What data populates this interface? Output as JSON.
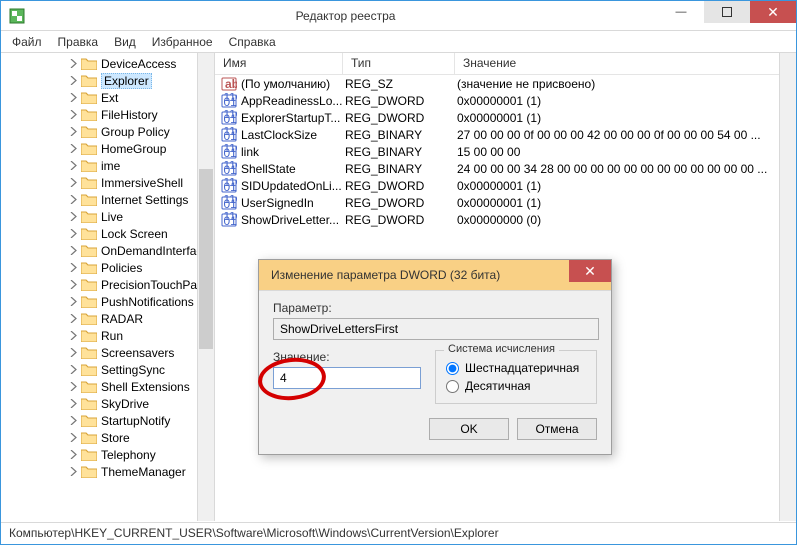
{
  "window": {
    "title": "Редактор реестра"
  },
  "menu": {
    "file": "Файл",
    "edit": "Правка",
    "view": "Вид",
    "fav": "Избранное",
    "help": "Справка"
  },
  "tree": {
    "items": [
      {
        "label": "DeviceAccess",
        "depth": 0,
        "exp": true
      },
      {
        "label": "Explorer",
        "depth": 0,
        "exp": true,
        "selected": true
      },
      {
        "label": "Ext",
        "depth": 0,
        "exp": false
      },
      {
        "label": "FileHistory",
        "depth": 0,
        "exp": false
      },
      {
        "label": "Group Policy",
        "depth": 0,
        "exp": false
      },
      {
        "label": "HomeGroup",
        "depth": 0,
        "exp": false
      },
      {
        "label": "ime",
        "depth": 0,
        "exp": false
      },
      {
        "label": "ImmersiveShell",
        "depth": 0,
        "exp": true
      },
      {
        "label": "Internet Settings",
        "depth": 0,
        "exp": true
      },
      {
        "label": "Live",
        "depth": 0,
        "exp": false
      },
      {
        "label": "Lock Screen",
        "depth": 0,
        "exp": false
      },
      {
        "label": "OnDemandInterfac",
        "depth": 0,
        "exp": false
      },
      {
        "label": "Policies",
        "depth": 0,
        "exp": true
      },
      {
        "label": "PrecisionTouchPa",
        "depth": 0,
        "exp": false
      },
      {
        "label": "PushNotifications",
        "depth": 0,
        "exp": true
      },
      {
        "label": "RADAR",
        "depth": 0,
        "exp": true
      },
      {
        "label": "Run",
        "depth": 0,
        "exp": false
      },
      {
        "label": "Screensavers",
        "depth": 0,
        "exp": true
      },
      {
        "label": "SettingSync",
        "depth": 0,
        "exp": true
      },
      {
        "label": "Shell Extensions",
        "depth": 0,
        "exp": true
      },
      {
        "label": "SkyDrive",
        "depth": 0,
        "exp": true
      },
      {
        "label": "StartupNotify",
        "depth": 0,
        "exp": false
      },
      {
        "label": "Store",
        "depth": 0,
        "exp": false
      },
      {
        "label": "Telephony",
        "depth": 0,
        "exp": true
      },
      {
        "label": "ThemeManager",
        "depth": 0,
        "exp": false
      }
    ]
  },
  "list": {
    "cols": {
      "name": "Имя",
      "type": "Тип",
      "value": "Значение"
    },
    "rows": [
      {
        "icon": "str",
        "name": "(По умолчанию)",
        "type": "REG_SZ",
        "value": "(значение не присвоено)"
      },
      {
        "icon": "bin",
        "name": "AppReadinessLo...",
        "type": "REG_DWORD",
        "value": "0x00000001 (1)"
      },
      {
        "icon": "bin",
        "name": "ExplorerStartupT...",
        "type": "REG_DWORD",
        "value": "0x00000001 (1)"
      },
      {
        "icon": "bin",
        "name": "LastClockSize",
        "type": "REG_BINARY",
        "value": "27 00 00 00 0f 00 00 00 42 00 00 00 0f 00 00 00 54 00 ..."
      },
      {
        "icon": "bin",
        "name": "link",
        "type": "REG_BINARY",
        "value": "15 00 00 00"
      },
      {
        "icon": "bin",
        "name": "ShellState",
        "type": "REG_BINARY",
        "value": "24 00 00 00 34 28 00 00 00 00 00 00 00 00 00 00 00 00 ..."
      },
      {
        "icon": "bin",
        "name": "SIDUpdatedOnLi...",
        "type": "REG_DWORD",
        "value": "0x00000001 (1)"
      },
      {
        "icon": "bin",
        "name": "UserSignedIn",
        "type": "REG_DWORD",
        "value": "0x00000001 (1)"
      },
      {
        "icon": "bin",
        "name": "ShowDriveLetter...",
        "type": "REG_DWORD",
        "value": "0x00000000 (0)"
      }
    ]
  },
  "dialog": {
    "title": "Изменение параметра DWORD (32 бита)",
    "param_label": "Параметр:",
    "param_value": "ShowDriveLettersFirst",
    "value_label": "Значение:",
    "value": "4",
    "radix_legend": "Система исчисления",
    "hex": "Шестнадцатеричная",
    "dec": "Десятичная",
    "ok": "OK",
    "cancel": "Отмена"
  },
  "statusbar": "Компьютер\\HKEY_CURRENT_USER\\Software\\Microsoft\\Windows\\CurrentVersion\\Explorer"
}
